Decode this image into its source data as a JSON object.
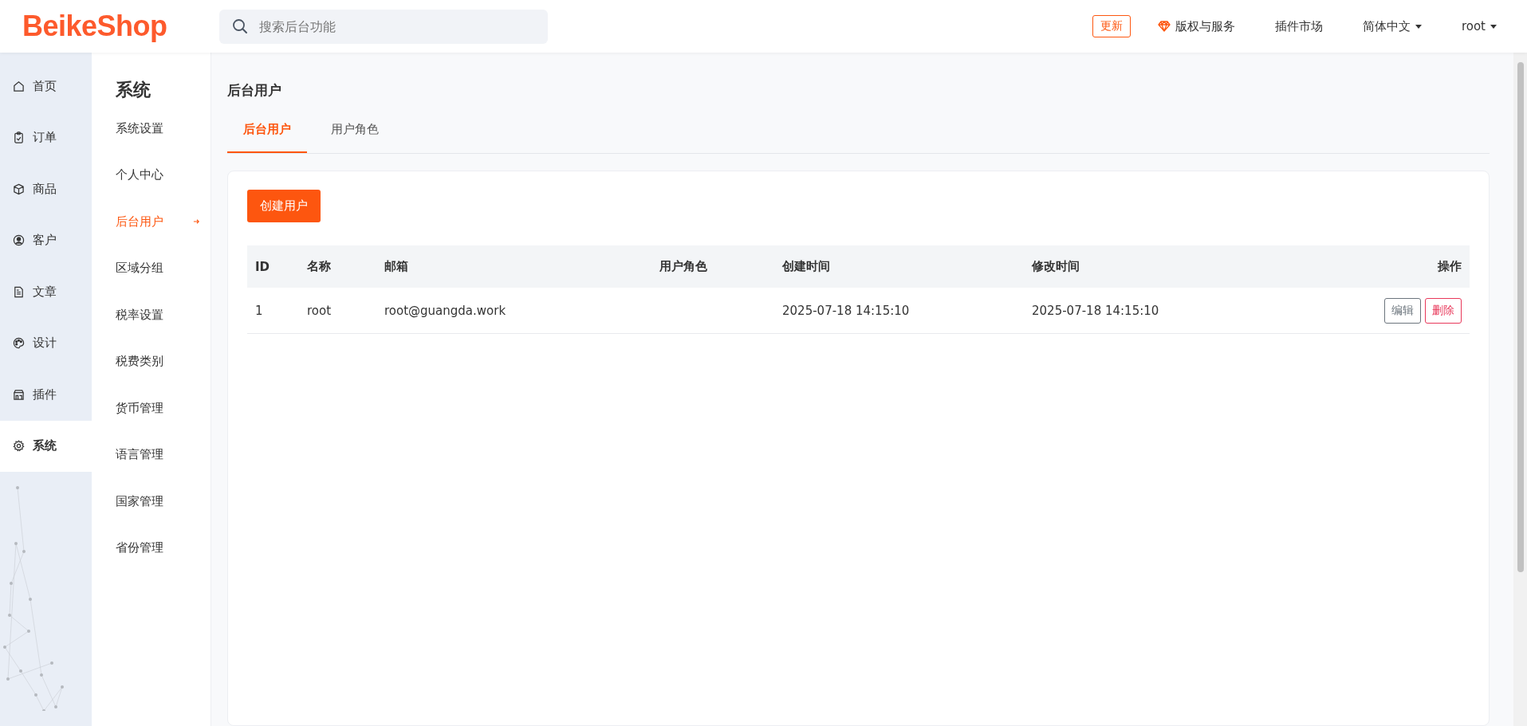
{
  "header": {
    "logo": "BeikeShop",
    "search": {
      "placeholder": "搜索后台功能"
    },
    "update_badge": "更新",
    "links": [
      {
        "label": "版权与服务",
        "kind": "diamond"
      },
      {
        "label": "插件市场",
        "kind": "plain"
      },
      {
        "label": "简体中文",
        "kind": "dropdown"
      },
      {
        "label": "root",
        "kind": "dropdown"
      }
    ]
  },
  "nav": [
    {
      "label": "首页",
      "kind": "home",
      "selected": false
    },
    {
      "label": "订单",
      "kind": "clipboard",
      "selected": false
    },
    {
      "label": "商品",
      "kind": "box",
      "selected": false
    },
    {
      "label": "客户",
      "kind": "user",
      "selected": false
    },
    {
      "label": "文章",
      "kind": "document",
      "selected": false
    },
    {
      "label": "设计",
      "kind": "palette",
      "selected": false
    },
    {
      "label": "插件",
      "kind": "store",
      "selected": false
    },
    {
      "label": "系统",
      "kind": "gear",
      "selected": true
    }
  ],
  "subnav": {
    "title": "系统",
    "items": [
      {
        "label": "系统设置",
        "selected": false
      },
      {
        "label": "个人中心",
        "selected": false
      },
      {
        "label": "后台用户",
        "selected": true
      },
      {
        "label": "区域分组",
        "selected": false
      },
      {
        "label": "税率设置",
        "selected": false
      },
      {
        "label": "税费类别",
        "selected": false
      },
      {
        "label": "货币管理",
        "selected": false
      },
      {
        "label": "语言管理",
        "selected": false
      },
      {
        "label": "国家管理",
        "selected": false
      },
      {
        "label": "省份管理",
        "selected": false
      }
    ]
  },
  "page_title": "后台用户",
  "tabs": [
    {
      "label": "后台用户",
      "selected": true
    },
    {
      "label": "用户角色",
      "selected": false
    }
  ],
  "create_button": "创建用户",
  "table": {
    "columns": [
      "ID",
      "名称",
      "邮箱",
      "用户角色",
      "创建时间",
      "修改时间",
      "操作"
    ],
    "rows": [
      {
        "cells": [
          "1",
          "root",
          "root@guangda.work",
          "",
          "2025-07-18 14:15:10",
          "2025-07-18 14:15:10"
        ],
        "actions": [
          {
            "label": "编辑",
            "kind": "edit"
          },
          {
            "label": "删除",
            "kind": "delete"
          }
        ]
      }
    ]
  }
}
